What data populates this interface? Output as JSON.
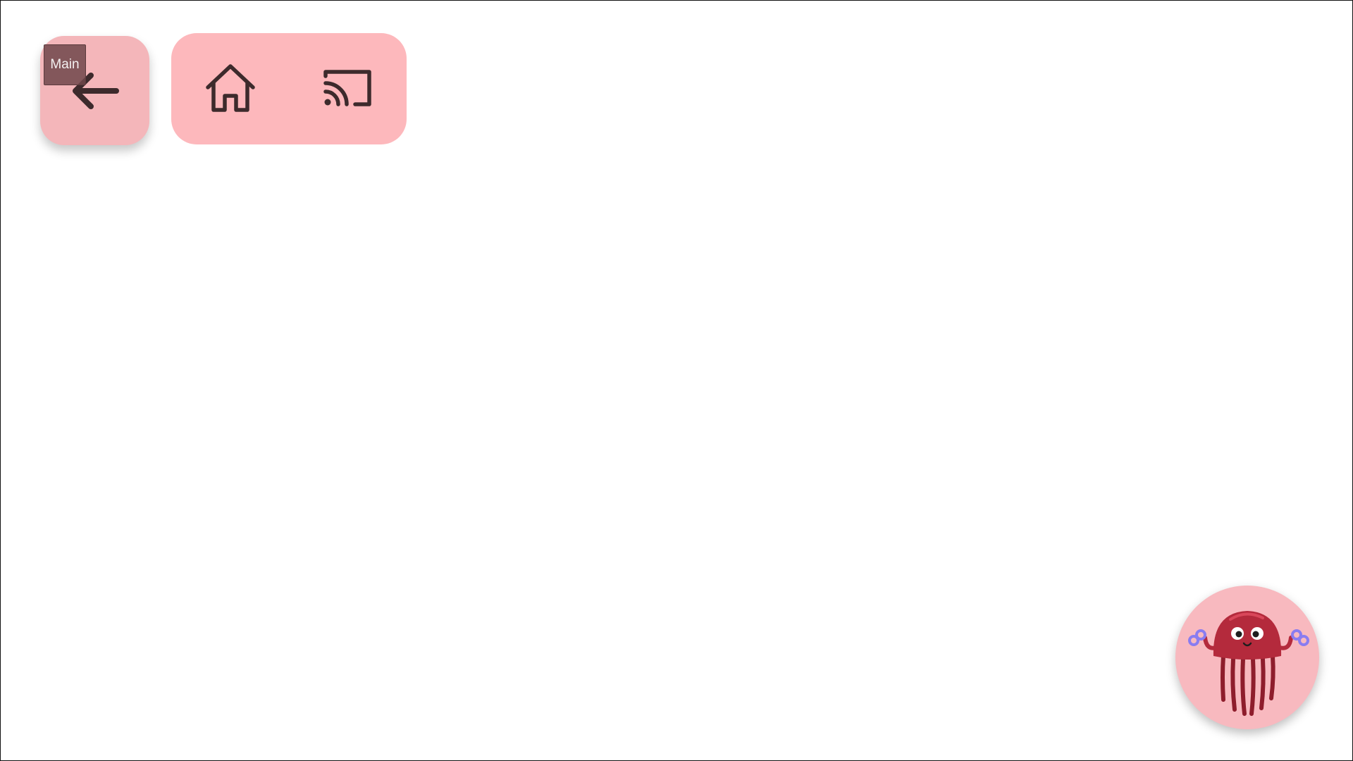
{
  "toolbar": {
    "back_icon": "arrow-left-icon",
    "tooltip_text": "Main",
    "nav_items": [
      {
        "icon": "home-icon"
      },
      {
        "icon": "cast-icon"
      }
    ]
  },
  "mascot": {
    "icon": "jellyfish-mascot"
  },
  "colors": {
    "back_button_bg": "#f4b6ba",
    "nav_group_bg": "#fdb8bc",
    "icon_stroke": "#3d2a2c",
    "mascot_bg": "#f8b9bf",
    "mascot_body": "#b42a3c"
  }
}
